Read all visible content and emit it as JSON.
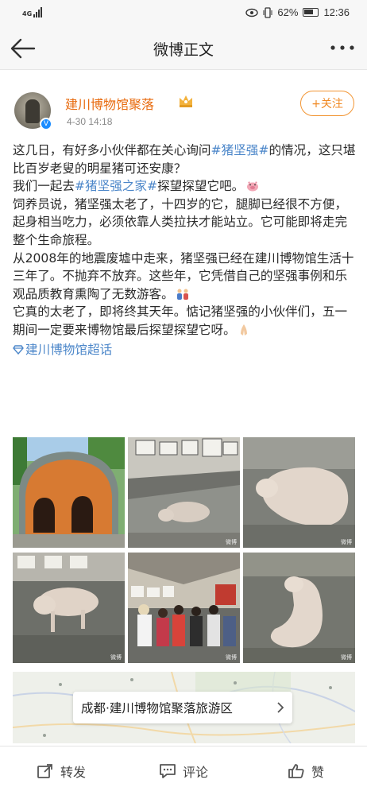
{
  "status_bar": {
    "signal": "4G",
    "battery": "62%",
    "time": "12:36"
  },
  "nav": {
    "title": "微博正文"
  },
  "author": {
    "name": "建川博物馆聚落",
    "time": "4-30 14:18",
    "follow_label": "+关注"
  },
  "post": {
    "p1_a": "这几日，有好多小伙伴都在关心询问",
    "p1_topic": "#猪坚强#",
    "p1_b": "的情况，这只堪比百岁老叟的明星猪可还安康？",
    "p2_a": "我们一起去",
    "p2_topic": "#猪坚强之家#",
    "p2_b": "探望探望它吧。",
    "p3": "饲养员说，猪坚强太老了，十四岁的它，腿脚已经很不方便，起身相当吃力，必须依靠人类拉扶才能站立。它可能即将走完整个生命旅程。",
    "p4": "从2008年的地震废墟中走来，猪坚强已经在建川博物馆生活十三年了。不抛弃不放弃。这些年，它凭借自己的坚强事例和乐观品质教育熏陶了无数游客。",
    "p5": "它真的太老了，即将终其天年。惦记猪坚强的小伙伴们，五一期间一定要来博物馆最后探望探望它呀。",
    "super_topic": "建川博物馆超话"
  },
  "location": {
    "label": "成都·建川博物馆聚落旅游区"
  },
  "actions": {
    "repost": "转发",
    "comment": "评论",
    "like": "赞"
  }
}
